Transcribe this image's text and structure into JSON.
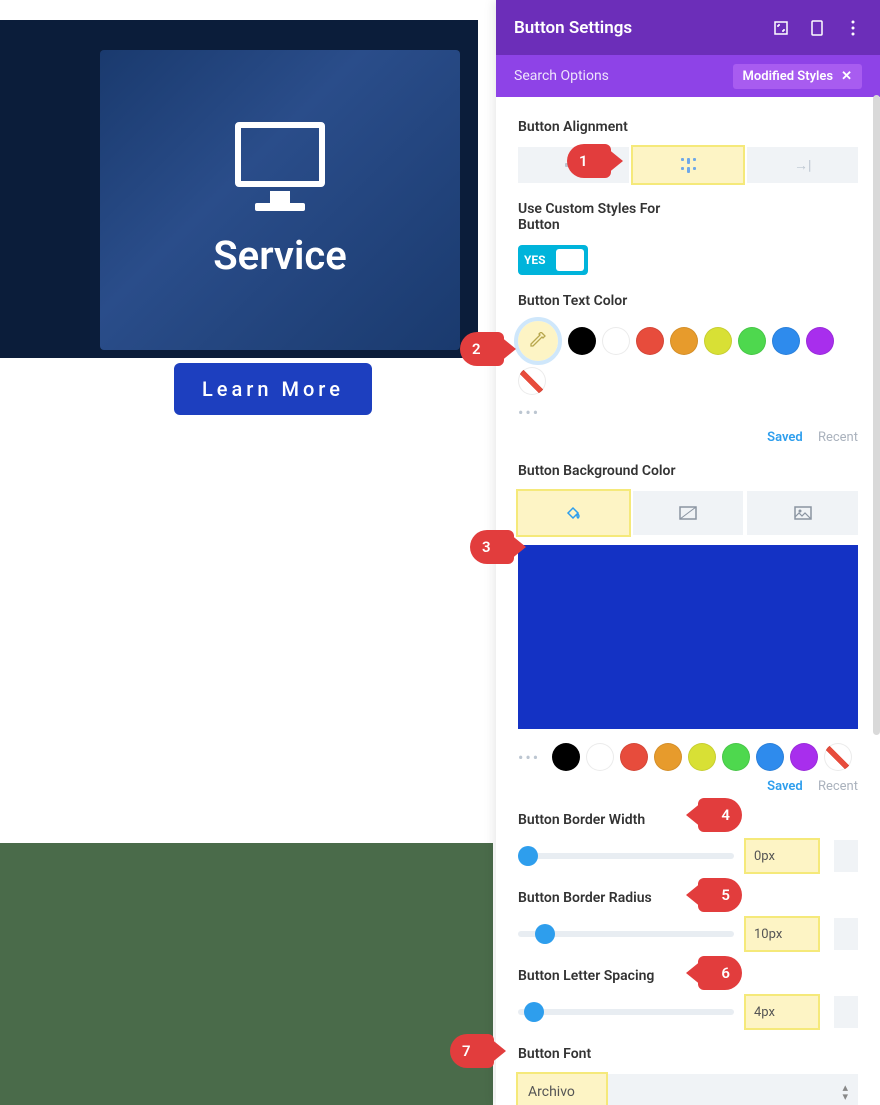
{
  "preview": {
    "card_title": "Service",
    "button_label": "Learn More"
  },
  "panel": {
    "title": "Button Settings",
    "search_placeholder": "Search Options",
    "modified_tag": "Modified Styles"
  },
  "sections": {
    "alignment_label": "Button Alignment",
    "custom_styles_label": "Use Custom Styles For Button",
    "toggle_yes": "YES",
    "text_color_label": "Button Text Color",
    "bg_color_label": "Button Background Color",
    "border_width_label": "Button Border Width",
    "border_radius_label": "Button Border Radius",
    "letter_spacing_label": "Button Letter Spacing",
    "font_label": "Button Font"
  },
  "swatch_colors": [
    "#000000",
    "#ffffff",
    "#e74c3c",
    "#e79b2c",
    "#d8e035",
    "#4ed84e",
    "#2e8bed",
    "#a82eed"
  ],
  "saved_recent": {
    "saved": "Saved",
    "recent": "Recent"
  },
  "bg_selected_color": "#1432c4",
  "sliders": {
    "border_width": "0px",
    "border_radius": "10px",
    "letter_spacing": "4px"
  },
  "font": {
    "selected": "Archivo"
  },
  "callouts": {
    "c1": "1",
    "c2": "2",
    "c3": "3",
    "c4": "4",
    "c5": "5",
    "c6": "6",
    "c7": "7"
  }
}
